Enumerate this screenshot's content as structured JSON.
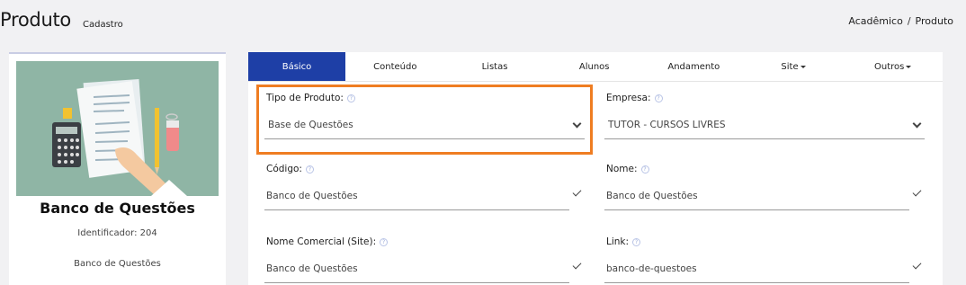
{
  "header": {
    "title": "Produto",
    "subtitle": "Cadastro",
    "breadcrumb": [
      "Acadêmico",
      "/",
      "Produto"
    ]
  },
  "card": {
    "name": "Banco de Questões",
    "identifier": "Identificador: 204",
    "type": "Banco de Questões"
  },
  "tabs": [
    {
      "label": "Básico",
      "active": true
    },
    {
      "label": "Conteúdo"
    },
    {
      "label": "Listas"
    },
    {
      "label": "Alunos"
    },
    {
      "label": "Andamento"
    },
    {
      "label": "Site",
      "dropdown": true
    },
    {
      "label": "Outros",
      "dropdown": true
    }
  ],
  "form": {
    "tipo_label": "Tipo de Produto:",
    "tipo_value": "Base de Questões",
    "empresa_label": "Empresa:",
    "empresa_value": "TUTOR - CURSOS LIVRES",
    "codigo_label": "Código:",
    "codigo_value": "Banco de Questões",
    "nome_label": "Nome:",
    "nome_value": "Banco de Questões",
    "nome_comercial_label": "Nome Comercial (Site):",
    "nome_comercial_value": "Banco de Questões",
    "link_label": "Link:",
    "link_value": "banco-de-questoes",
    "help_glyph": "?"
  },
  "colors": {
    "active_tab": "#1e3fa6",
    "highlight": "#ef7d22",
    "image_bg": "#8fb5a5"
  }
}
